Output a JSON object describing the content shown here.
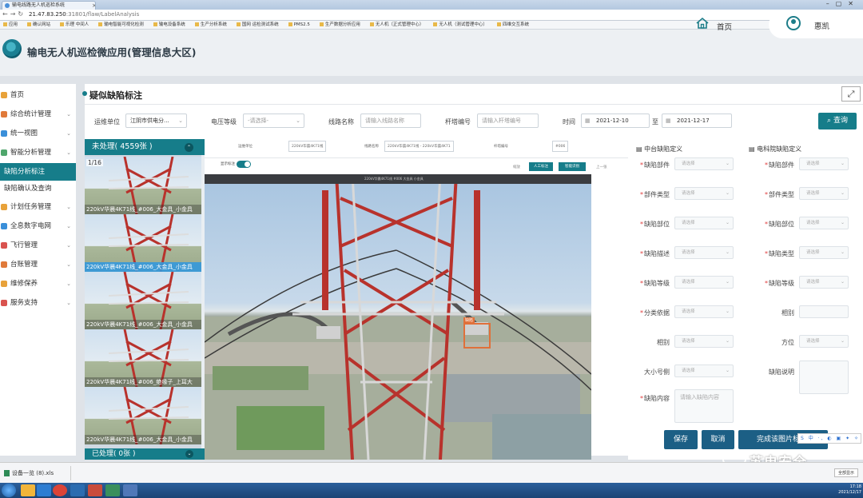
{
  "browser": {
    "tab_title": "输电线路无人机巡检系统",
    "url_host": "21.47.83.250",
    "url_path": ":31801/flaw/LabelAnalysis",
    "bookmarks": [
      "应用",
      "确认网站",
      "乐理 中间人",
      "输电智能可视化检测",
      "输电设备系统",
      "生产分析系统",
      "国网 运检测试系统",
      "PMS2.5",
      "生产数据分析应用",
      "无人机（正式管理中心）",
      "无人机（测试管理中心）",
      "四维交互系统"
    ]
  },
  "app": {
    "title": "输电无人机巡检微应用(管理信息大区)",
    "home": "首页",
    "user": "惠凯"
  },
  "sidebar": {
    "items": [
      {
        "label": "首页",
        "color": "#e8a23a"
      },
      {
        "label": "综合统计管理",
        "color": "#e07a3a"
      },
      {
        "label": "统一视图",
        "color": "#3a8fd9"
      },
      {
        "label": "智能分析管理",
        "color": "#4fa66c"
      },
      {
        "label": "缺陷分析标注"
      },
      {
        "label": "缺陷确认及查询"
      },
      {
        "label": "计划任务管理",
        "color": "#e8a23a"
      },
      {
        "label": "全息数字电网",
        "color": "#3a8fd9"
      },
      {
        "label": "飞行管理",
        "color": "#d9534f"
      },
      {
        "label": "台账管理",
        "color": "#e07a3a"
      },
      {
        "label": "维修保养",
        "color": "#e8a23a"
      },
      {
        "label": "服务支持",
        "color": "#d9534f"
      }
    ]
  },
  "panel": {
    "title": "疑似缺陷标注"
  },
  "filters": {
    "unit_label": "运维单位",
    "unit_value": "江阴市供电分...",
    "voltage_label": "电压等级",
    "voltage_placeholder": "-请选择-",
    "line_label": "线路名称",
    "line_placeholder": "请输入线路名称",
    "tower_label": "杆塔编号",
    "tower_placeholder": "请输入杆塔编号",
    "time_label": "时间",
    "date_from": "2021-12-10",
    "date_sep": "至",
    "date_to": "2021-12-17",
    "query_label": "查询"
  },
  "list": {
    "pending_label": "未处理( 4559张 )",
    "processed_label": "已处理( 0张 )",
    "counter": "1/16",
    "items": [
      "220kV华晨4K71线_#006_大金具_小金具",
      "220kV华晨4K71线_#006_大金具_小金具",
      "220kV华晨4K71线_#006_大金具_小金具",
      "220kV华晨4K71线_#006_绝缘子_上耳大",
      "220kV华晨4K71线_#006_大金具_小金具"
    ]
  },
  "viewer": {
    "top_fields": [
      "运维单位",
      "220kV华晨4K71线",
      "线路名称",
      "220kV华晨4K71线 - 220kV华晨4K71",
      "杆塔编号",
      "#006"
    ],
    "switch_label": "显示标注",
    "tool_hint": "缩放",
    "tool_btn1": "人工标注",
    "tool_btn2": "智能识别",
    "tool_hint2": "上一张",
    "strip_text": "220kV华晨4K71线 #006 大金具 小金具",
    "bbox_label": "缺陷"
  },
  "form": {
    "left_head": "中台缺陷定义",
    "right_head": "电科院缺陷定义",
    "select_placeholder": "请选择",
    "textarea_placeholder": "请输入缺陷内容",
    "left_fields": [
      {
        "label": "缺陷部件",
        "required": true
      },
      {
        "label": "部件类型",
        "required": true
      },
      {
        "label": "缺陷部位",
        "required": true
      },
      {
        "label": "缺陷描述",
        "required": true
      },
      {
        "label": "缺陷等级",
        "required": true
      },
      {
        "label": "分类依据",
        "required": true
      },
      {
        "label": "相别",
        "required": false
      },
      {
        "label": "大小号侧",
        "required": false
      },
      {
        "label": "缺陷内容",
        "required": true
      }
    ],
    "right_fields": [
      {
        "label": "缺陷部件",
        "required": true
      },
      {
        "label": "部件类型",
        "required": true
      },
      {
        "label": "缺陷部位",
        "required": true
      },
      {
        "label": "缺陷类型",
        "required": true
      },
      {
        "label": "缺陷等级",
        "required": true
      },
      {
        "label": "相别",
        "required": false
      },
      {
        "label": "方位",
        "required": false
      },
      {
        "label": "缺陷说明",
        "required": false
      }
    ],
    "save_label": "保存",
    "cancel_label": "取消",
    "complete_label": "完成该图片标注"
  },
  "ime": "S 中 ·, ◐ ▣ ✦ ✧",
  "watermark": "苏电安全",
  "download": {
    "file": "设备一览 (8).xls",
    "show_all": "全部显示"
  },
  "tray": {
    "time": "17:18",
    "date": "2021/12/17"
  }
}
